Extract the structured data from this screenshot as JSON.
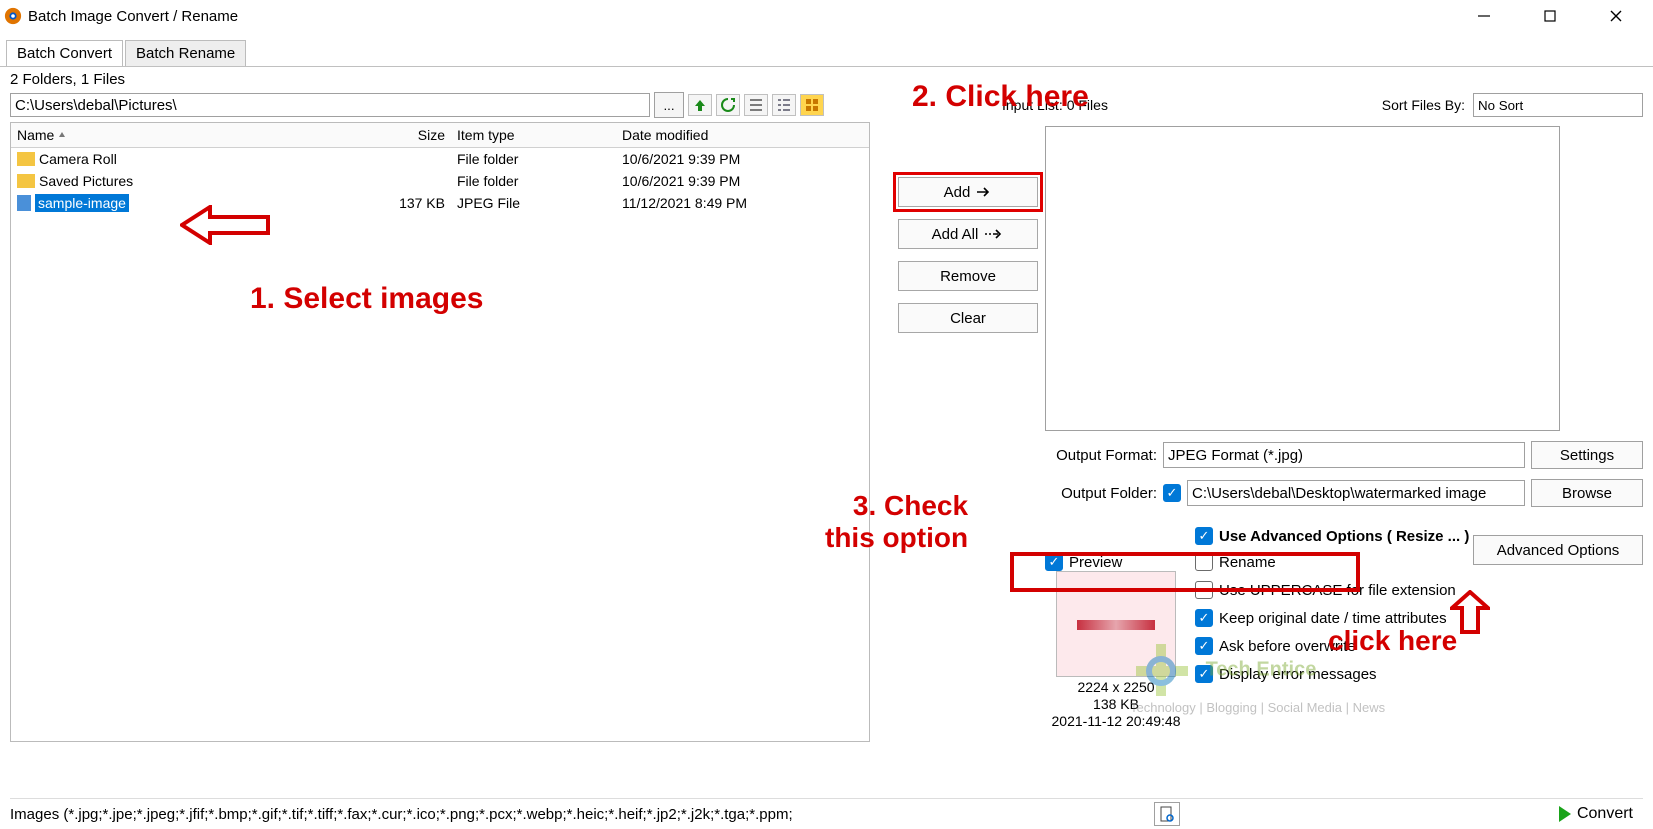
{
  "window": {
    "title": "Batch Image Convert / Rename"
  },
  "tabs": {
    "convert": "Batch Convert",
    "rename": "Batch Rename"
  },
  "status_summary": "2 Folders, 1 Files",
  "path": "C:\\Users\\debal\\Pictures\\",
  "file_headers": {
    "name": "Name",
    "size": "Size",
    "type": "Item type",
    "date": "Date modified"
  },
  "files": [
    {
      "name": "Camera Roll",
      "size": "",
      "type": "File folder",
      "date": "10/6/2021 9:39 PM",
      "icon": "folder",
      "selected": false
    },
    {
      "name": "Saved Pictures",
      "size": "",
      "type": "File folder",
      "date": "10/6/2021 9:39 PM",
      "icon": "folder",
      "selected": false
    },
    {
      "name": "sample-image",
      "size": "137 KB",
      "type": "JPEG File",
      "date": "11/12/2021 8:49 PM",
      "icon": "file",
      "selected": true
    }
  ],
  "buttons": {
    "add": "Add",
    "addall": "Add All",
    "remove": "Remove",
    "clear": "Clear",
    "settings": "Settings",
    "browse": "Browse",
    "advanced": "Advanced Options",
    "convert": "Convert"
  },
  "input_list": {
    "label": "Input List:",
    "count": "0 Files",
    "sort_label": "Sort Files By:",
    "sort_value": "No Sort"
  },
  "output": {
    "format_label": "Output Format:",
    "format_value": "JPEG Format (*.jpg)",
    "folder_label": "Output Folder:",
    "folder_value": "C:\\Users\\debal\\Desktop\\watermarked image"
  },
  "options": {
    "use_adv": "Use Advanced Options ( Resize ... )",
    "preview": "Preview",
    "rename": "Rename",
    "uppercase": "Use UPPERCASE for file extension",
    "keepdate": "Keep original date / time attributes",
    "askoverwrite": "Ask before overwrite",
    "displayerrors": "Display error messages"
  },
  "preview_meta": {
    "dims": "2224 x 2250",
    "size": "138 KB",
    "date": "2021-11-12 20:49:48"
  },
  "footer_filter": "Images (*.jpg;*.jpe;*.jpeg;*.jfif;*.bmp;*.gif;*.tif;*.tiff;*.fax;*.cur;*.ico;*.png;*.pcx;*.webp;*.heic;*.heif;*.jp2;*.j2k;*.tga;*.ppm;",
  "annotations": {
    "t1": "1. Select images",
    "t2": "2. Click here",
    "t3a": "3. Check",
    "t3b": "this option",
    "t4": "click here"
  },
  "watermark": {
    "brand": "Tech Entice",
    "tagline": "Technology | Blogging | Social Media | News"
  }
}
